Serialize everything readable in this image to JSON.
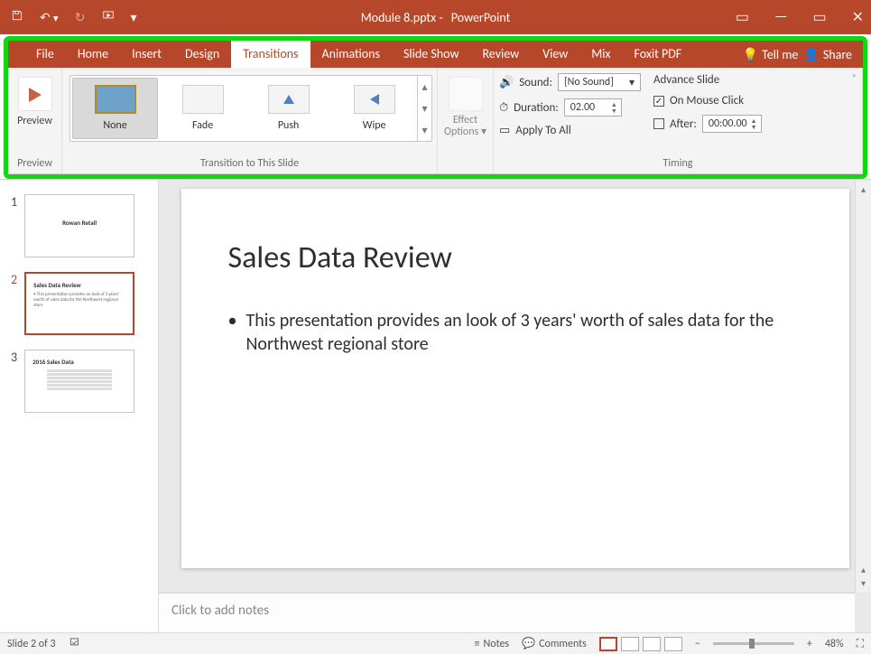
{
  "title": {
    "doc": "Module 8.pptx",
    "sep": "-",
    "app": "PowerPoint"
  },
  "qat": {
    "save": "save-icon",
    "undo": "undo-icon",
    "redo": "redo-icon",
    "startbegin": "start-from-beginning-icon",
    "more": "▾"
  },
  "win": {
    "ribbonopts": "▭",
    "min": "—",
    "max": "▭",
    "close": "✕"
  },
  "menu": {
    "tabs": [
      "File",
      "Home",
      "Insert",
      "Design",
      "Transitions",
      "Animations",
      "Slide Show",
      "Review",
      "View",
      "Mix",
      "Foxit PDF"
    ],
    "active_index": 4,
    "tellme": "Tell me",
    "share": "Share"
  },
  "ribbon": {
    "preview": {
      "label": "Preview",
      "btn": "Preview"
    },
    "gallery": {
      "label": "Transition to This Slide",
      "items": [
        {
          "name": "None",
          "selected": true,
          "kind": "none"
        },
        {
          "name": "Fade",
          "selected": false,
          "kind": "fade"
        },
        {
          "name": "Push",
          "selected": false,
          "kind": "push"
        },
        {
          "name": "Wipe",
          "selected": false,
          "kind": "wipe"
        }
      ]
    },
    "effect_options": {
      "label": "Effect\nOptions",
      "drop": "▾"
    },
    "timing": {
      "label": "Timing",
      "sound_lbl": "Sound:",
      "sound_val": "[No Sound]",
      "duration_lbl": "Duration:",
      "duration_val": "02.00",
      "apply_all": "Apply To All",
      "advance_lbl": "Advance Slide",
      "on_click_lbl": "On Mouse Click",
      "on_click_checked": true,
      "after_lbl": "After:",
      "after_val": "00:00.00",
      "after_checked": false
    }
  },
  "slides": {
    "items": [
      {
        "num": "1",
        "title": "Rowan Retail",
        "sub": "",
        "active": false
      },
      {
        "num": "2",
        "title": "Sales Data Review",
        "sub": "• This presentation provides an look of 3 years' worth of sales data for the Northwest regional store",
        "active": true
      },
      {
        "num": "3",
        "title": "2016 Sales Data",
        "sub": "",
        "active": false
      }
    ]
  },
  "canvas": {
    "title": "Sales Data Review",
    "bullet": "This presentation provides an look of 3 years' worth of sales data for the Northwest regional store"
  },
  "notes_placeholder": "Click to add notes",
  "status": {
    "slide": "Slide 2 of 3",
    "notes": "Notes",
    "comments": "Comments",
    "zoom": "48%"
  }
}
